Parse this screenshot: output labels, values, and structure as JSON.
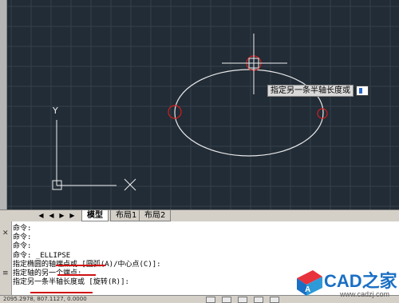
{
  "drawing": {
    "dynamic_prompt": "指定另一条半轴长度或",
    "ucs_x_label": "X",
    "ucs_y_label": "Y"
  },
  "tabs": [
    {
      "label": "模型",
      "active": true
    },
    {
      "label": "布局1",
      "active": false
    },
    {
      "label": "布局2",
      "active": false
    }
  ],
  "nav_buttons": [
    "◀",
    "◀",
    "▶",
    "▶"
  ],
  "command_history": [
    "命令:",
    "命令:",
    "命令:",
    "命令: _ELLIPSE",
    "指定椭圆的轴端点或 [圆弧(A)/中心点(C)]:",
    "指定轴的另一个端点:",
    "指定另一条半轴长度或 [旋转(R)]:"
  ],
  "status": {
    "coordinates": "2095.2978, 807.1127, 0.0000"
  },
  "watermark": {
    "brand": "CAD之家",
    "url": "www.cadzj.com"
  },
  "colors": {
    "canvas_bg": "#222c36",
    "grid": "#34404b",
    "entity": "#e8e8e8",
    "grip_marker": "#d02020",
    "annotation_underline": "#d01010",
    "brand_blue": "#1a6fc4"
  }
}
